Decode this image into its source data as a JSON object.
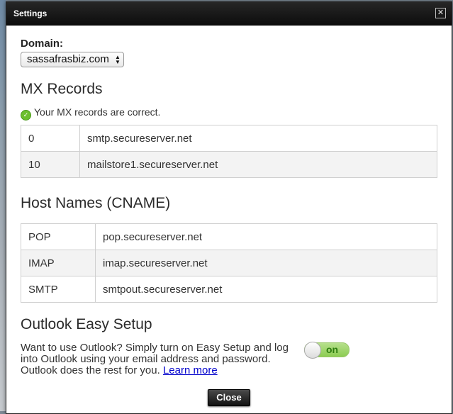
{
  "dialog": {
    "title": "Settings",
    "close_glyph": "✕",
    "close_button_label": "Close"
  },
  "domain": {
    "label": "Domain:",
    "selected": "sassafrasbiz.com"
  },
  "mx": {
    "heading": "MX Records",
    "status": "Your MX records are correct.",
    "rows": [
      {
        "priority": "0",
        "host": "smtp.secureserver.net"
      },
      {
        "priority": "10",
        "host": "mailstore1.secureserver.net"
      }
    ]
  },
  "cname": {
    "heading": "Host Names (CNAME)",
    "rows": [
      {
        "name": "POP",
        "host": "pop.secureserver.net"
      },
      {
        "name": "IMAP",
        "host": "imap.secureserver.net"
      },
      {
        "name": "SMTP",
        "host": "smtpout.secureserver.net"
      }
    ]
  },
  "outlook": {
    "heading": "Outlook Easy Setup",
    "description": "Want to use Outlook? Simply turn on Easy Setup and log into Outlook using your email address and password. Outlook does the rest for you.",
    "learn_more": "Learn more",
    "toggle_label": "on",
    "toggle_state": "on"
  },
  "icons": {
    "check": "check-circle-icon",
    "close": "close-icon",
    "select_arrows": "up-down-arrows-icon"
  },
  "colors": {
    "titlebar": "#111111",
    "toggle_on": "#8ccc52",
    "link": "#0000cc",
    "status_ok": "#6cbf2d"
  }
}
